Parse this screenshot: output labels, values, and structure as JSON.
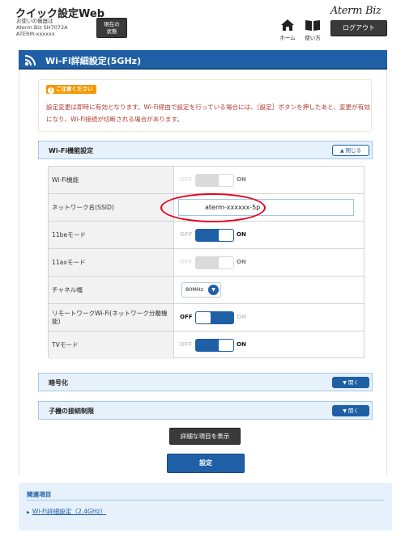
{
  "header": {
    "app_title": "クイック設定Web",
    "device_label": "お使いの機器は",
    "device_model": "Aterm Biz SH7072A",
    "device_id": "ATERM-xxxxxx",
    "status_button_line1": "現在の",
    "status_button_line2": "状態",
    "brand": "Aterm Biz",
    "home_label": "ホーム",
    "guide_label": "使い方",
    "logout_label": "ログアウト"
  },
  "page": {
    "title": "Wi-Fi詳細設定(5GHz)"
  },
  "notice": {
    "badge": "ご注意ください",
    "text": "設定変更は即時に有効となります。Wi-Fi経由で設定を行っている場合には、［設定］ボタンを押したあと、変更が有効になり、Wi-Fi接続が切断される場合があります。"
  },
  "sections": {
    "wifi_function": {
      "label": "Wi-Fi機能設定",
      "toggle": "閉じる"
    },
    "encryption": {
      "label": "暗号化",
      "toggle": "開く"
    },
    "access_limit": {
      "label": "子機の接続制限",
      "toggle": "開く"
    }
  },
  "switch_labels": {
    "off": "OFF",
    "on": "ON"
  },
  "settings": {
    "wifi_function": {
      "label": "Wi-Fi機能",
      "state": "off"
    },
    "ssid": {
      "label": "ネットワーク名(SSID)",
      "value": "aterm-xxxxxx-5p"
    },
    "mode_11be": {
      "label": "11beモード",
      "state": "on"
    },
    "mode_11ax": {
      "label": "11axモード",
      "state": "off"
    },
    "channel_width": {
      "label": "チャネル幅",
      "value": "80MHz"
    },
    "remote_network": {
      "label": "リモートワークWi-Fi(ネットワーク分離機能)",
      "state": "off"
    },
    "tv_mode": {
      "label": "TVモード",
      "state": "on"
    }
  },
  "buttons": {
    "show_details": "詳細な項目を表示",
    "apply": "設定"
  },
  "related": {
    "heading": "関連項目",
    "link": "Wi-Fi詳細設定（2.4GHz）"
  },
  "colors": {
    "primary": "#1f5fa6",
    "notice_badge": "#f39800",
    "notice_text": "#b03a2e",
    "highlight_circle": "#e5001e"
  }
}
